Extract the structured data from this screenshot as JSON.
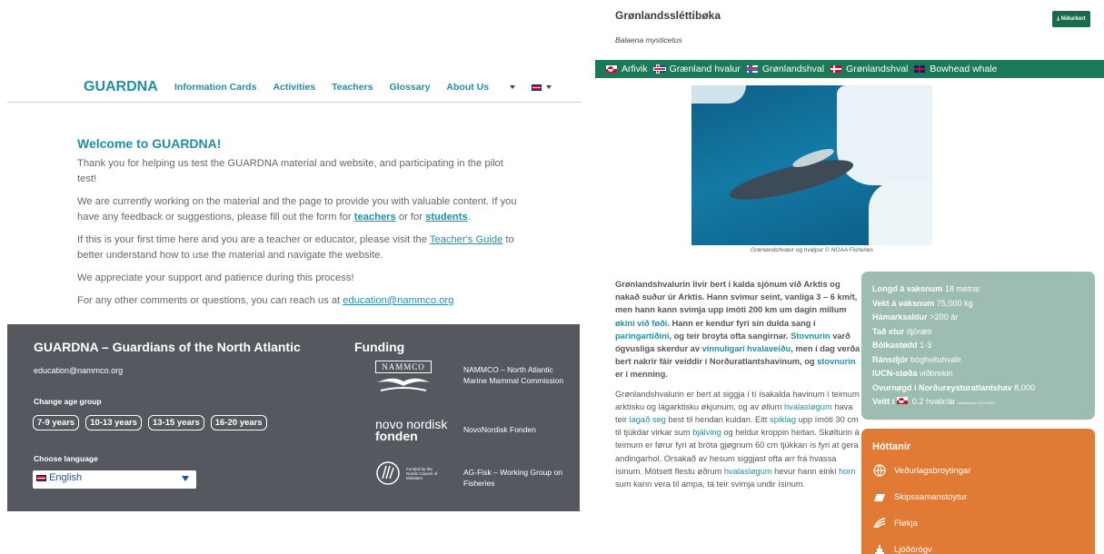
{
  "left": {
    "nav": {
      "brand": "GUARDNA",
      "links": [
        "Information Cards",
        "Activities",
        "Teachers",
        "Glossary",
        "About Us"
      ]
    },
    "welcome": {
      "heading": "Welcome to GUARDNA!",
      "p1": "Thank you for helping us test the GUARDNA material and website, and participating in the pilot test!",
      "p2a": "We are currently working on the material and the page to provide you with valuable content. If you have any feedback or suggestions, please fill out the form for ",
      "p2_teachers": "teachers",
      "p2b": " or for ",
      "p2_students": "students",
      "p2c": ".",
      "p3a": "If this is your first time here and you are a teacher or educator, please visit the ",
      "p3_link": "Teacher's Guide",
      "p3b": " to better understand how to use the material and navigate the website.",
      "p4": "We appreciate your support and patience during this process!",
      "p5a": "For any other comments or questions, you can reach us at ",
      "p5_link": "education@nammco.org"
    },
    "footer": {
      "title": "GUARDNA – Guardians of the North Atlantic",
      "email": "education@nammco.org",
      "age_label": "Change age group",
      "age_groups": [
        "7-9 years",
        "10-13 years",
        "13-15 years",
        "16-20 years"
      ],
      "lang_label": "Choose language",
      "lang_value": "English",
      "funding_title": "Funding",
      "funders": [
        {
          "logo": "NAMMCO",
          "name": "NAMMCO – North Atlantic Marine Mammal Commission"
        },
        {
          "logo_line1": "novo nordisk",
          "logo_line2": "fonden",
          "name": "NovoNordisk Fonden"
        },
        {
          "logo": "Funded by the Nordic Council of Ministers",
          "name": "AG-Fisk – Working Group on Fisheries"
        }
      ]
    }
  },
  "right": {
    "title": "Grønlandssléttibøka",
    "latin": "Balaena mysticetus",
    "download": "Niðurkort",
    "names": [
      "Arfivik",
      "Grænland hvalur",
      "Grønlandshval",
      "Grønlandshval",
      "Bowhead whale"
    ],
    "caption": "Grønlandshvalur og hválpur © NOAA Fisheries",
    "body": {
      "p1_lead": "Grønlandshvalurin livir bert í kalda sjónum við Arktis og nakað suður úr Arktis. Hann svimur seint, vanliga 3 – 6 km/t, men hann kann svimja upp ímóti 200 km um dagin millum ",
      "p1_link1": "økini við føði",
      "p1_mid1": ". Hann er kendur fyri sín dulda sang í ",
      "p1_link2": "paringartíðini",
      "p1_mid2": ", og teir broyta ofta sangirnar. ",
      "p1_link3": "Stovnurin",
      "p1_mid3": " varð ógvusliga skerdur av ",
      "p1_link4": "vinnuligari hvalaveiðu",
      "p1_mid4": ", men í dag verða bert nakrir fáir veiddir í Norðuratlantshavinum, og ",
      "p1_link5": "stovnurin",
      "p1_end": " er í menning.",
      "p2a": "Grønlandshvalurin er bert at siggja í tí ísakalda havinum í teimum arktisku og lágarktisku økjunum, og av øllum ",
      "p2_link1": "hvalasløgum",
      "p2b": " hava teir ",
      "p2_link2": "lagað seg",
      "p2c": " best til hendan kuldan. Eitt ",
      "p2_link3": "spiklag",
      "p2d": " upp ímóti 30 cm til tjúkdar virkar sum ",
      "p2_link4": "bjálving",
      "p2e": " og heldur kroppin heitan. Skølturin á teimum er førur fyri at bróta gjøgnum 60 cm tjúkkan ís fyri at gera andingarhol. Orsakað av hesum siggjast ofta arr frá hvassa ísinum. Mótsett flestu øðrum ",
      "p2_link5": "hvalasløgum",
      "p2f": " hevur hann einki ",
      "p2_link6": "horn",
      "p2g": " sum kann vera til ampa, tá teir svimja undir ísinum."
    },
    "facts": [
      {
        "label": "Longd á vaksnum",
        "value": "18 metrar"
      },
      {
        "label": "Vekt á vaksnum",
        "value": "75,000 kg"
      },
      {
        "label": "Hámarksaldur",
        "value": ">200 ár"
      },
      {
        "label": "Tað etur",
        "value": "djóræti"
      },
      {
        "label": "Bólkastødd",
        "value": "1-3"
      },
      {
        "label": "Ránsdjór",
        "value": "bóghvituhvalir"
      },
      {
        "label": "IUCN-støða",
        "value": "viðbrekin"
      },
      {
        "label": "Ovurnøgd í Norðureysturatlantshav",
        "value": "8,000"
      }
    ],
    "catch": {
      "label": "Veitt í",
      "value": "0.2 hvalir/ár",
      "note": "miðaltal fyri 2019-2023"
    },
    "threats": {
      "title": "Hóttanir",
      "items": [
        {
          "icon": "climate-icon",
          "label": "Veðurlagsbroytingar"
        },
        {
          "icon": "ship-icon",
          "label": "Skipssamanstoytur"
        },
        {
          "icon": "ice-icon",
          "label": "Fløkja"
        },
        {
          "icon": "noise-icon",
          "label": "Ljóðórógv"
        }
      ]
    }
  }
}
